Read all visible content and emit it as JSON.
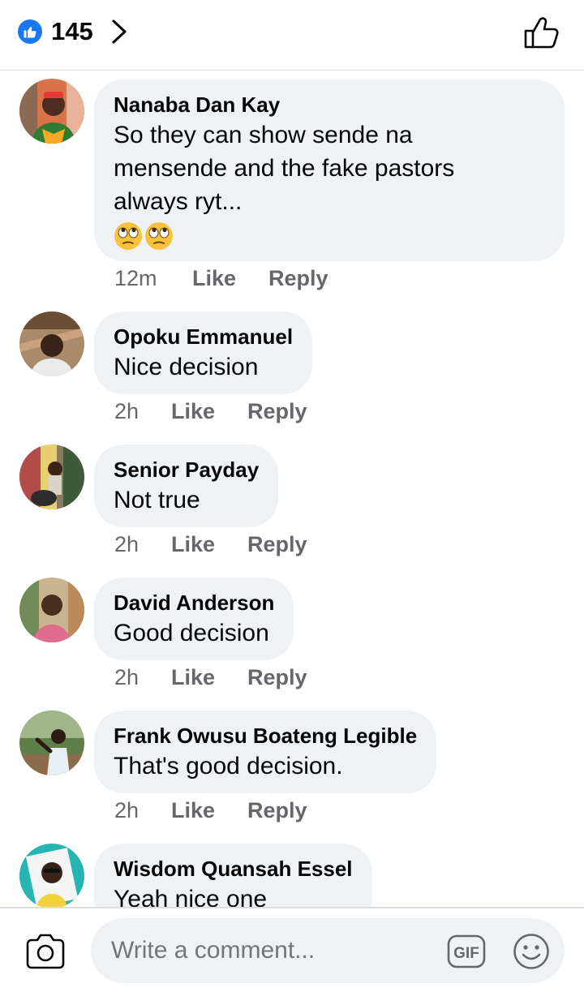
{
  "header": {
    "reaction_count": "145",
    "like_badge_color": "#1877f2"
  },
  "comments": [
    {
      "author": "Nanaba Dan Kay",
      "text": "So they can show sende na\nmensende and the fake pastors\nalways ryt...",
      "emoji": [
        "face-with-rolling-eyes",
        "face-with-rolling-eyes"
      ],
      "time": "12m",
      "like_label": "Like",
      "reply_label": "Reply"
    },
    {
      "author": "Opoku Emmanuel",
      "text": "Nice decision",
      "time": "2h",
      "like_label": "Like",
      "reply_label": "Reply"
    },
    {
      "author": "Senior Payday",
      "text": "Not true",
      "time": "2h",
      "like_label": "Like",
      "reply_label": "Reply"
    },
    {
      "author": "David Anderson",
      "text": "Good decision",
      "time": "2h",
      "like_label": "Like",
      "reply_label": "Reply"
    },
    {
      "author": "Frank Owusu Boateng Legible",
      "text": "That's good decision.",
      "time": "2h",
      "like_label": "Like",
      "reply_label": "Reply"
    },
    {
      "author": "Wisdom Quansah Essel",
      "text": "Yeah nice one"
    }
  ],
  "composer": {
    "placeholder": "Write a comment...",
    "gif_label": "GIF"
  }
}
